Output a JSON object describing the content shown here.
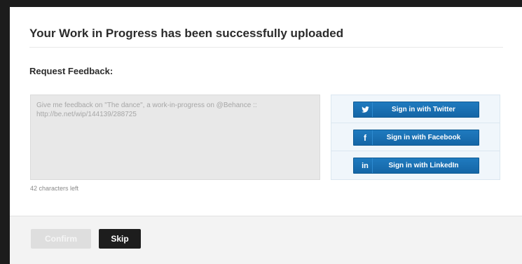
{
  "dialog": {
    "title": "Your Work in Progress has been successfully uploaded",
    "subheading": "Request Feedback:"
  },
  "feedback": {
    "text": "Give me feedback on \"The dance\", a work-in-progress on @Behance :: http://be.net/wip/144139/288725",
    "chars_left": "42 characters left"
  },
  "social": [
    {
      "icon": "twitter-icon",
      "glyph": "♥",
      "label": "Sign in with Twitter"
    },
    {
      "icon": "facebook-icon",
      "glyph": "f",
      "label": "Sign in with Facebook"
    },
    {
      "icon": "linkedin-icon",
      "glyph": "in",
      "label": "Sign in with LinkedIn"
    }
  ],
  "footer": {
    "confirm_label": "Confirm",
    "skip_label": "Skip"
  },
  "colors": {
    "social_button": "#1a72b5",
    "skip_button": "#1d1d1d",
    "confirm_disabled": "#dedede"
  }
}
